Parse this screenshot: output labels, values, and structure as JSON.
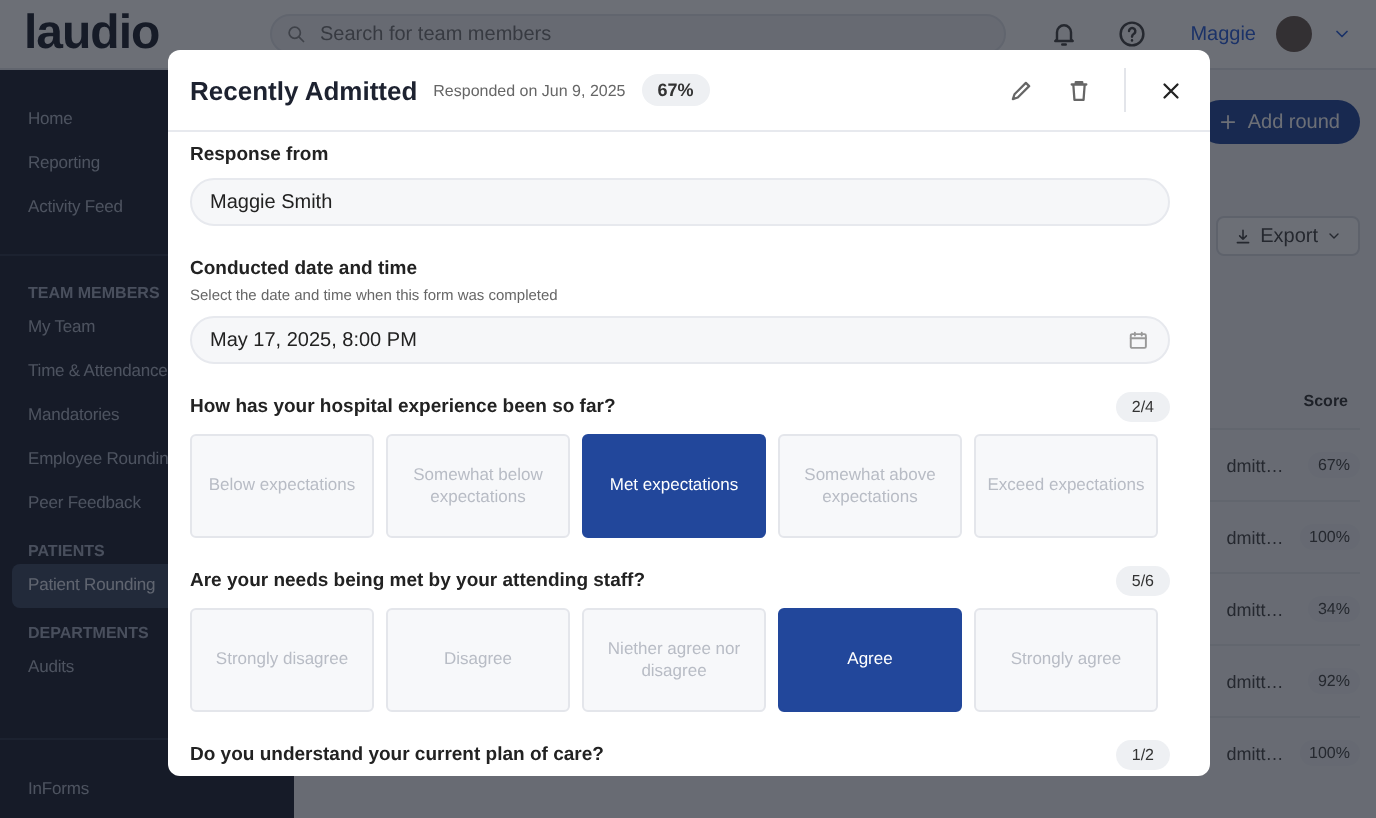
{
  "topbar": {
    "logo": "laudio",
    "search": {
      "placeholder": "Search for team members"
    },
    "user": "Maggie"
  },
  "sidebar": {
    "sections": [
      {
        "items": [
          {
            "label": "Home",
            "selected": false
          },
          {
            "label": "Reporting",
            "selected": false
          },
          {
            "label": "Activity Feed",
            "selected": false
          }
        ]
      },
      {
        "heading": "TEAM MEMBERS",
        "items": [
          {
            "label": "My Team",
            "selected": false
          },
          {
            "label": "Time & Attendance",
            "selected": false
          },
          {
            "label": "Mandatories",
            "selected": false
          },
          {
            "label": "Employee Roundin",
            "selected": false
          },
          {
            "label": "Peer Feedback",
            "selected": false
          }
        ]
      },
      {
        "heading": "PATIENTS",
        "items": [
          {
            "label": "Patient Rounding",
            "selected": true
          }
        ]
      },
      {
        "heading": "DEPARTMENTS",
        "items": [
          {
            "label": "Audits",
            "selected": false
          }
        ]
      },
      {
        "items": [
          {
            "label": "InForms",
            "selected": false
          }
        ]
      }
    ]
  },
  "main": {
    "add_button": "Add round",
    "export_button": "Export",
    "table": {
      "columns": [
        "Score"
      ],
      "rows": [
        {
          "name": "dmitt…",
          "score": "67%"
        },
        {
          "name": "dmitt…",
          "score": "100%"
        },
        {
          "name": "dmitt…",
          "score": "34%"
        },
        {
          "name": "dmitt…",
          "score": "92%"
        },
        {
          "name": "dmitt…",
          "score": "100%"
        }
      ]
    }
  },
  "modal": {
    "title": "Recently Admitted",
    "subtitle": "Responded on Jun 9, 2025",
    "score": "67%",
    "response_label": "Response from",
    "response_value": "Maggie Smith",
    "date_label": "Conducted date and time",
    "date_hint": "Select the date and time when this form was completed",
    "date_value": "May 17, 2025, 8:00 PM",
    "questions": [
      {
        "text": "How has your hospital experience been so far?",
        "count": "2/4",
        "options": [
          {
            "label": "Below expectations",
            "selected": false
          },
          {
            "label": "Somewhat below expectations",
            "selected": false
          },
          {
            "label": "Met expectations",
            "selected": true
          },
          {
            "label": "Somewhat above expectations",
            "selected": false
          },
          {
            "label": "Exceed expectations",
            "selected": false
          }
        ]
      },
      {
        "text": "Are your needs being met by your attending staff?",
        "count": "5/6",
        "options": [
          {
            "label": "Strongly disagree",
            "selected": false
          },
          {
            "label": "Disagree",
            "selected": false
          },
          {
            "label": "Niether agree nor disagree",
            "selected": false
          },
          {
            "label": "Agree",
            "selected": true
          },
          {
            "label": "Strongly agree",
            "selected": false
          }
        ]
      },
      {
        "text": "Do you understand your current plan of care?",
        "count": "1/2"
      }
    ]
  }
}
